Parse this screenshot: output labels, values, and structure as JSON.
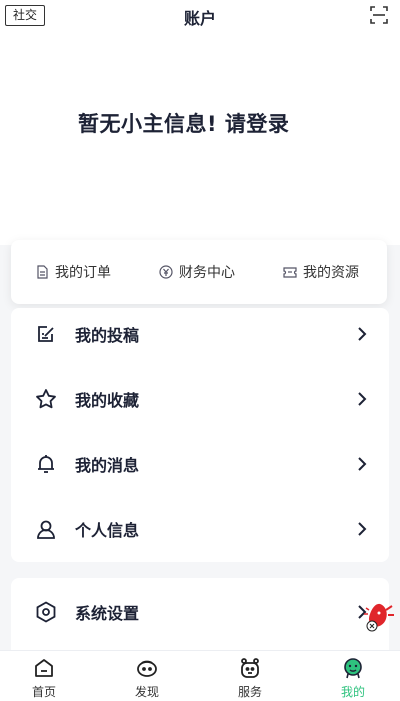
{
  "header": {
    "social_label": "社交",
    "title": "账户",
    "scan_icon": "scan-icon"
  },
  "login": {
    "prompt": "暂无小主信息! 请登录"
  },
  "quick_actions": [
    {
      "label": "我的订单",
      "icon": "order-doc-icon"
    },
    {
      "label": "财务中心",
      "icon": "yen-coin-icon"
    },
    {
      "label": "我的资源",
      "icon": "ticket-icon"
    }
  ],
  "menu_group1": [
    {
      "label": "我的投稿",
      "icon": "edit-note-icon"
    },
    {
      "label": "我的收藏",
      "icon": "star-icon"
    },
    {
      "label": "我的消息",
      "icon": "bell-icon"
    },
    {
      "label": "个人信息",
      "icon": "user-icon"
    }
  ],
  "menu_group2": [
    {
      "label": "系统设置",
      "icon": "settings-hexagon-icon"
    }
  ],
  "tabbar": [
    {
      "label": "首页",
      "icon": "home-icon"
    },
    {
      "label": "发现",
      "icon": "discover-face-icon"
    },
    {
      "label": "服务",
      "icon": "service-bear-icon"
    },
    {
      "label": "我的",
      "icon": "mine-face-icon",
      "active": true
    }
  ],
  "colors": {
    "accent": "#2ec27e",
    "text_dark": "#1d2235",
    "background": "#f5f6f8"
  }
}
